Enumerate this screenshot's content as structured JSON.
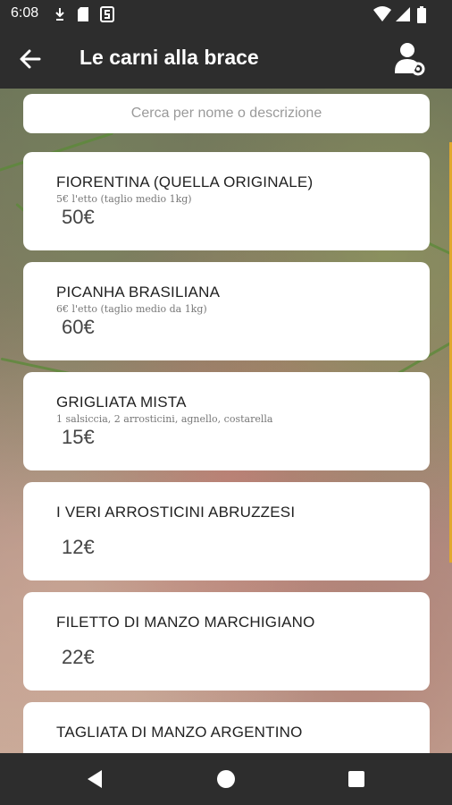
{
  "status_bar": {
    "time": "6:08",
    "icons": [
      "download-icon",
      "sd-card-icon",
      "app-s-icon",
      "wifi-icon",
      "signal-icon",
      "battery-icon"
    ]
  },
  "app_bar": {
    "title": "Le carni alla brace",
    "back_icon": "arrow-back-icon",
    "account_icon": "account-settings-icon"
  },
  "search": {
    "placeholder": "Cerca per nome o descrizione",
    "value": ""
  },
  "items": [
    {
      "name": "FIORENTINA (QUELLA ORIGINALE)",
      "description": "5€ l'etto (taglio medio 1kg)",
      "price": "50€"
    },
    {
      "name": "PICANHA BRASILIANA",
      "description": "6€ l'etto (taglio medio da 1kg)",
      "price": "60€"
    },
    {
      "name": "GRIGLIATA MISTA",
      "description": "1 salsiccia, 2 arrosticini, agnello, costarella",
      "price": "15€"
    },
    {
      "name": "I VERI ARROSTICINI ABRUZZESI",
      "description": "",
      "price": "12€"
    },
    {
      "name": "FILETTO DI MANZO MARCHIGIANO",
      "description": "",
      "price": "22€"
    },
    {
      "name": "TAGLIATA DI MANZO ARGENTINO",
      "description": "",
      "price": ""
    }
  ],
  "nav_bar": {
    "icons": [
      "back-triangle-icon",
      "home-circle-icon",
      "recents-square-icon"
    ]
  },
  "colors": {
    "bars": "#2d2d2d",
    "card": "#ffffff",
    "accent": "#e0a82e"
  }
}
